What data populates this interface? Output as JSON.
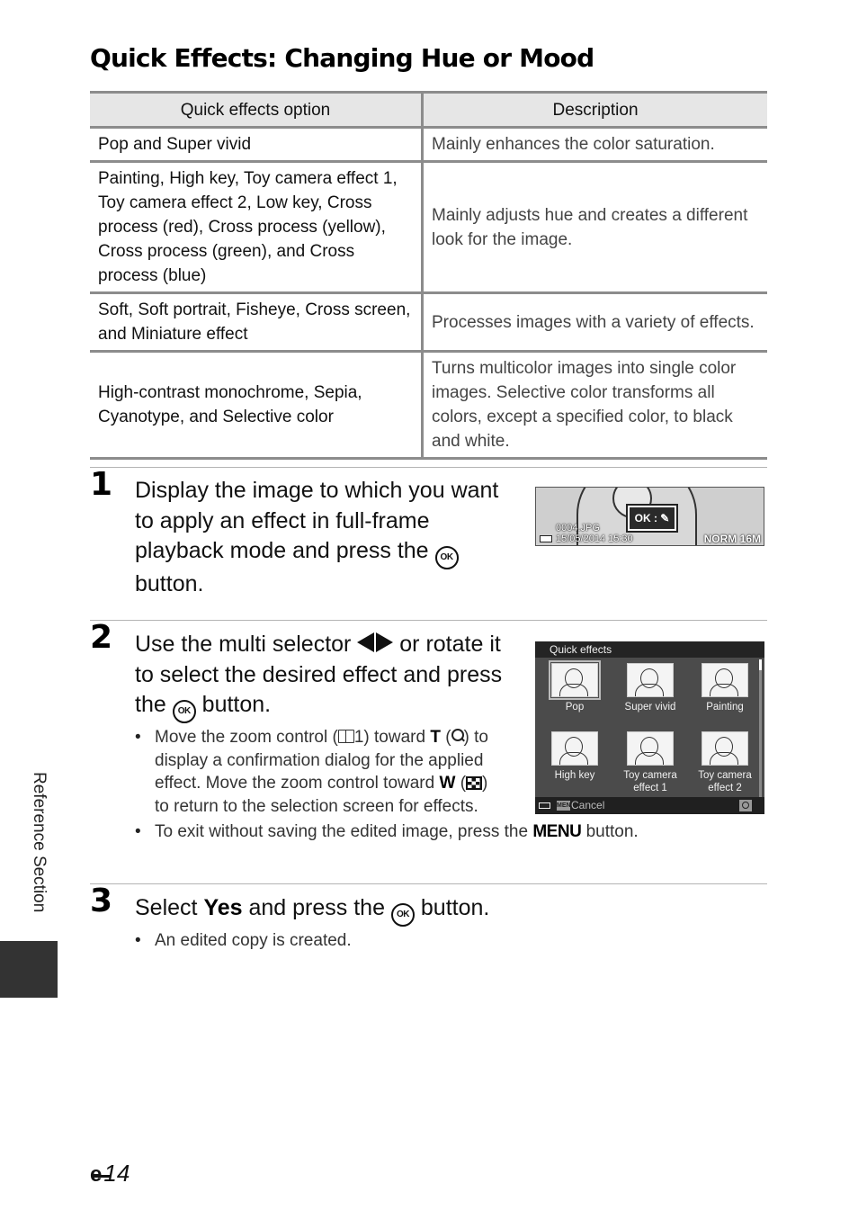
{
  "page": {
    "title": "Quick Effects: Changing Hue or Mood",
    "side_label": "Reference Section",
    "page_number_prefix_icon": "e-reference-icon",
    "page_number": "14"
  },
  "table": {
    "headers": [
      "Quick effects option",
      "Description"
    ],
    "rows": [
      {
        "option": "Pop and Super vivid",
        "description": "Mainly enhances the color saturation."
      },
      {
        "option": "Painting, High key, Toy camera effect 1, Toy camera effect 2, Low key, Cross process (red), Cross process (yellow), Cross process (green), and Cross process (blue)",
        "description": "Mainly adjusts hue and creates a different look for the image."
      },
      {
        "option": "Soft, Soft portrait, Fisheye, Cross screen, and Miniature effect",
        "description": "Processes images with a variety of effects."
      },
      {
        "option": "High-contrast monochrome, Sepia, Cyanotype, and Selective color",
        "description": "Turns multicolor images into single color images. Selective color transforms all colors, except a specified color, to black and white."
      }
    ]
  },
  "steps": [
    {
      "number": "1",
      "text_before": "Display the image to which you want to apply an effect in full-frame playback mode and press the",
      "ok_label": "OK",
      "text_after": "button."
    },
    {
      "number": "2",
      "text_before": "Use the multi selector",
      "text_middle": "or rotate it to select the desired effect and press the",
      "ok_label": "OK",
      "text_after": "button.",
      "bullets": {
        "b1_part1": "Move the zoom control (",
        "b1_ref": "1",
        "b1_part2": ") toward",
        "b1_T": "T",
        "b1_part3": "to display a confirmation dialog for the applied effect. Move the zoom control toward",
        "b1_W": "W",
        "b1_part4": "to return to the selection screen for effects.",
        "b2_part1": "To exit without saving the edited image, press the",
        "b2_menu": "MENU",
        "b2_part2": "button."
      }
    },
    {
      "number": "3",
      "text_before": "Select",
      "bold": "Yes",
      "text_middle": "and press the",
      "ok_label": "OK",
      "text_after": "button.",
      "bullet": "An edited copy is created."
    }
  ],
  "camera_screen_1": {
    "ok_prompt": "OK",
    "file_name": "0004.JPG",
    "datetime": "15/05/2014 15:30",
    "quality": "NORM",
    "size": "16M"
  },
  "camera_screen_2": {
    "header": "Quick effects",
    "effects": [
      "Pop",
      "Super vivid",
      "Painting",
      "High key",
      "Toy camera effect 1",
      "Toy camera effect 2"
    ],
    "selected_index": 0,
    "menu_key": "MENU",
    "cancel_label": "Cancel"
  }
}
